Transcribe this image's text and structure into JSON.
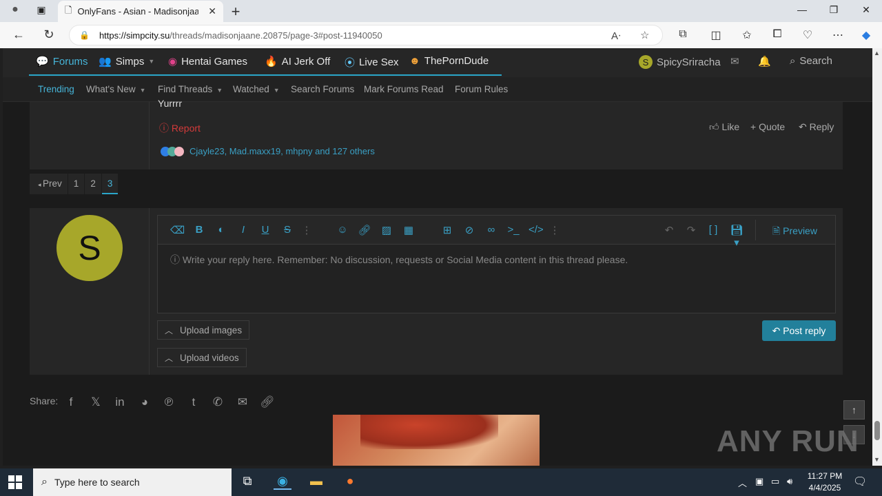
{
  "browser": {
    "tab_title": "OnlyFans - Asian - Madisonjaane",
    "url_host": "https://simpcity.su",
    "url_path": "/threads/madisonjaane.20875/page-3#post-11940050"
  },
  "site": {
    "nav": {
      "forums": "Forums",
      "simps": "Simps",
      "hentai": "Hentai Games",
      "aijerk": "AI Jerk Off",
      "livesex": "Live Sex",
      "porndude": "ThePornDude",
      "username": "SpicySriracha",
      "user_initial": "S",
      "search": "Search"
    },
    "subnav": {
      "trending": "Trending",
      "whats_new": "What's New",
      "find_threads": "Find Threads",
      "watched": "Watched",
      "search_forums": "Search Forums",
      "mark_read": "Mark Forums Read",
      "rules": "Forum Rules"
    }
  },
  "post": {
    "body_text": "Yurrrr",
    "report": "Report",
    "like": "Like",
    "quote": "Quote",
    "reply": "Reply",
    "reactions_text": "Cjayle23, Mad.maxx19, mhpny and 127 others"
  },
  "pagination": {
    "prev": "Prev",
    "pages": [
      "1",
      "2",
      "3"
    ]
  },
  "reply_form": {
    "avatar_initial": "S",
    "placeholder": "Write your reply here. Remember: No discussion, requests or Social Media content in this thread please.",
    "preview": "Preview",
    "upload_images": "Upload images",
    "upload_videos": "Upload videos",
    "post_reply": "Post reply"
  },
  "share": {
    "label": "Share:"
  },
  "watermark": "ANY RUN",
  "taskbar": {
    "search_placeholder": "Type here to search",
    "time": "11:27 PM",
    "date": "4/4/2025"
  }
}
